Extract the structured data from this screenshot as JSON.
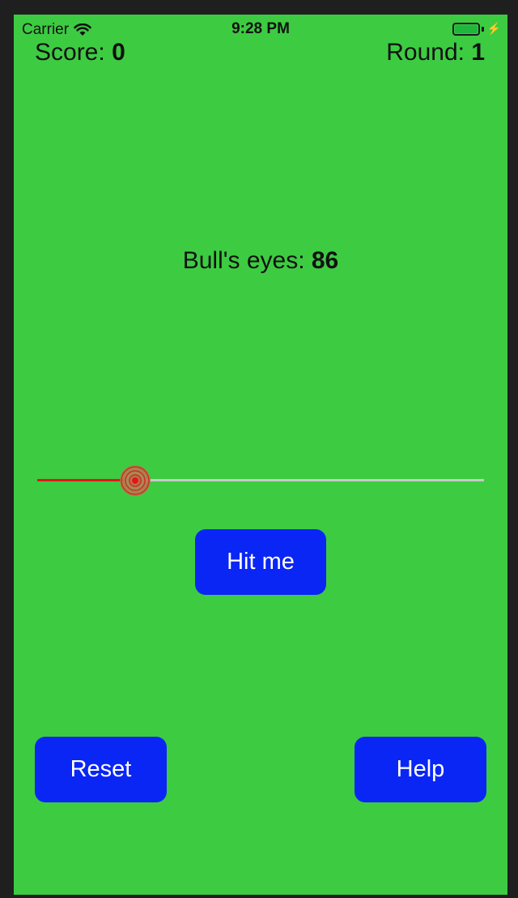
{
  "status_bar": {
    "carrier": "Carrier",
    "time": "9:28 PM",
    "wifi_icon": "wifi-icon",
    "battery_icon": "battery-icon",
    "charging_icon": "charging-bolt-icon"
  },
  "header": {
    "score_label": "Score:",
    "score_value": "0",
    "round_label": "Round:",
    "round_value": "1"
  },
  "target": {
    "label": "Bull's eyes:",
    "value": "86"
  },
  "slider": {
    "value_fraction": 0.22,
    "thumb_icon": "bullseye-icon"
  },
  "buttons": {
    "hit_label": "Hit me",
    "reset_label": "Reset",
    "help_label": "Help"
  },
  "colors": {
    "background": "#3dcb42",
    "button": "#0a26f5",
    "slider_min_track": "#e5141c",
    "slider_max_track": "#c8c8c8"
  }
}
